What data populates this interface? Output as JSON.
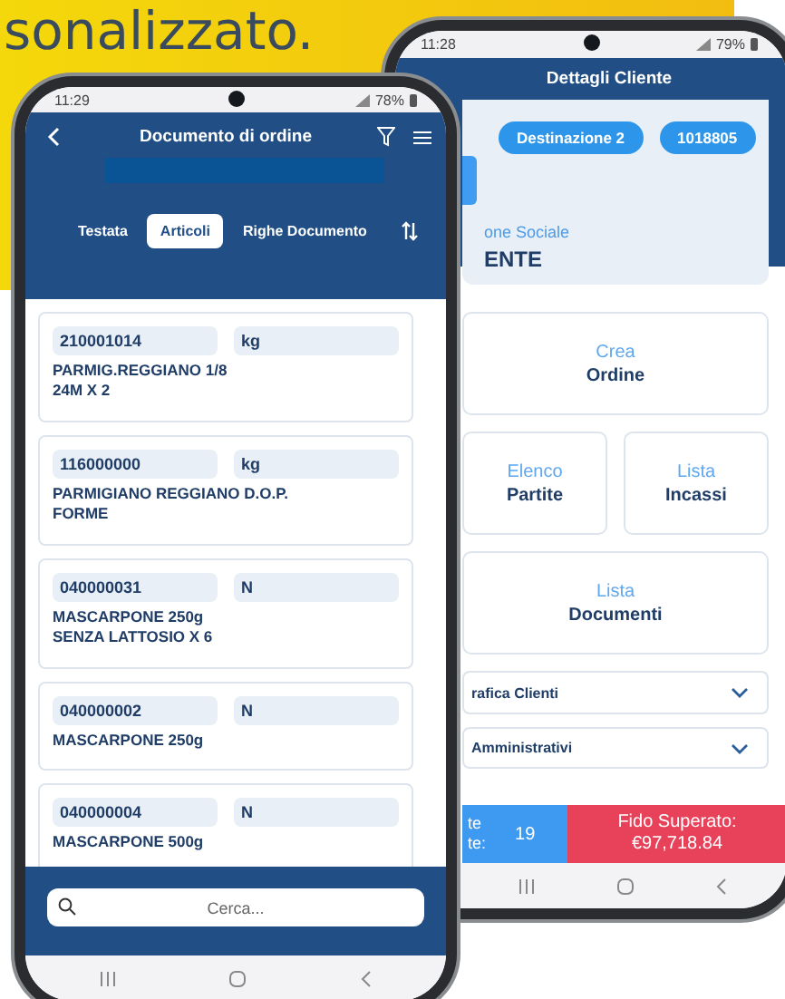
{
  "headline": "sonalizzato.",
  "back_phone": {
    "status_bar": {
      "time": "11:28",
      "battery": "79%"
    },
    "title": "Dettagli Cliente",
    "chips": [
      "Destinazione 2",
      "1018805"
    ],
    "field": {
      "label": "one Sociale",
      "value": "ENTE"
    },
    "actions": [
      {
        "kind": "wide",
        "line1": "Crea",
        "line2": "Ordine"
      },
      {
        "kind": "half",
        "line1": "Elenco",
        "line2": "Partite"
      },
      {
        "kind": "half",
        "line1": "Lista",
        "line2": "Incassi"
      },
      {
        "kind": "wide",
        "line1": "Lista",
        "line2": "Documenti"
      }
    ],
    "sections": [
      {
        "label": "rafica Clienti",
        "expanded": false
      },
      {
        "label": "Amministrativi",
        "expanded": false
      }
    ],
    "footer": {
      "label_lines": [
        "te",
        "te:"
      ],
      "count": "19",
      "alert_lines": [
        "Fido Superato:",
        "€97,718.84"
      ]
    }
  },
  "front_phone": {
    "status_bar": {
      "time": "11:29",
      "battery": "78%"
    },
    "title": "Documento di ordine",
    "tabs": [
      {
        "label": "Testata",
        "selected": false
      },
      {
        "label": "Articoli",
        "selected": true
      },
      {
        "label": "Righe Documento",
        "selected": false
      }
    ],
    "items": [
      {
        "code": "210001014",
        "unit": "kg",
        "name": "PARMIG.REGGIANO 1/8\n24M X 2"
      },
      {
        "code": "116000000",
        "unit": "kg",
        "name": "PARMIGIANO REGGIANO D.O.P.\nFORME"
      },
      {
        "code": "040000031",
        "unit": "N",
        "name": "MASCARPONE 250g\nSENZA  LATTOSIO X 6"
      },
      {
        "code": "040000002",
        "unit": "N",
        "name": "MASCARPONE 250g"
      },
      {
        "code": "040000004",
        "unit": "N",
        "name": "MASCARPONE 500g"
      }
    ],
    "search": {
      "placeholder": "Cerca..."
    }
  }
}
